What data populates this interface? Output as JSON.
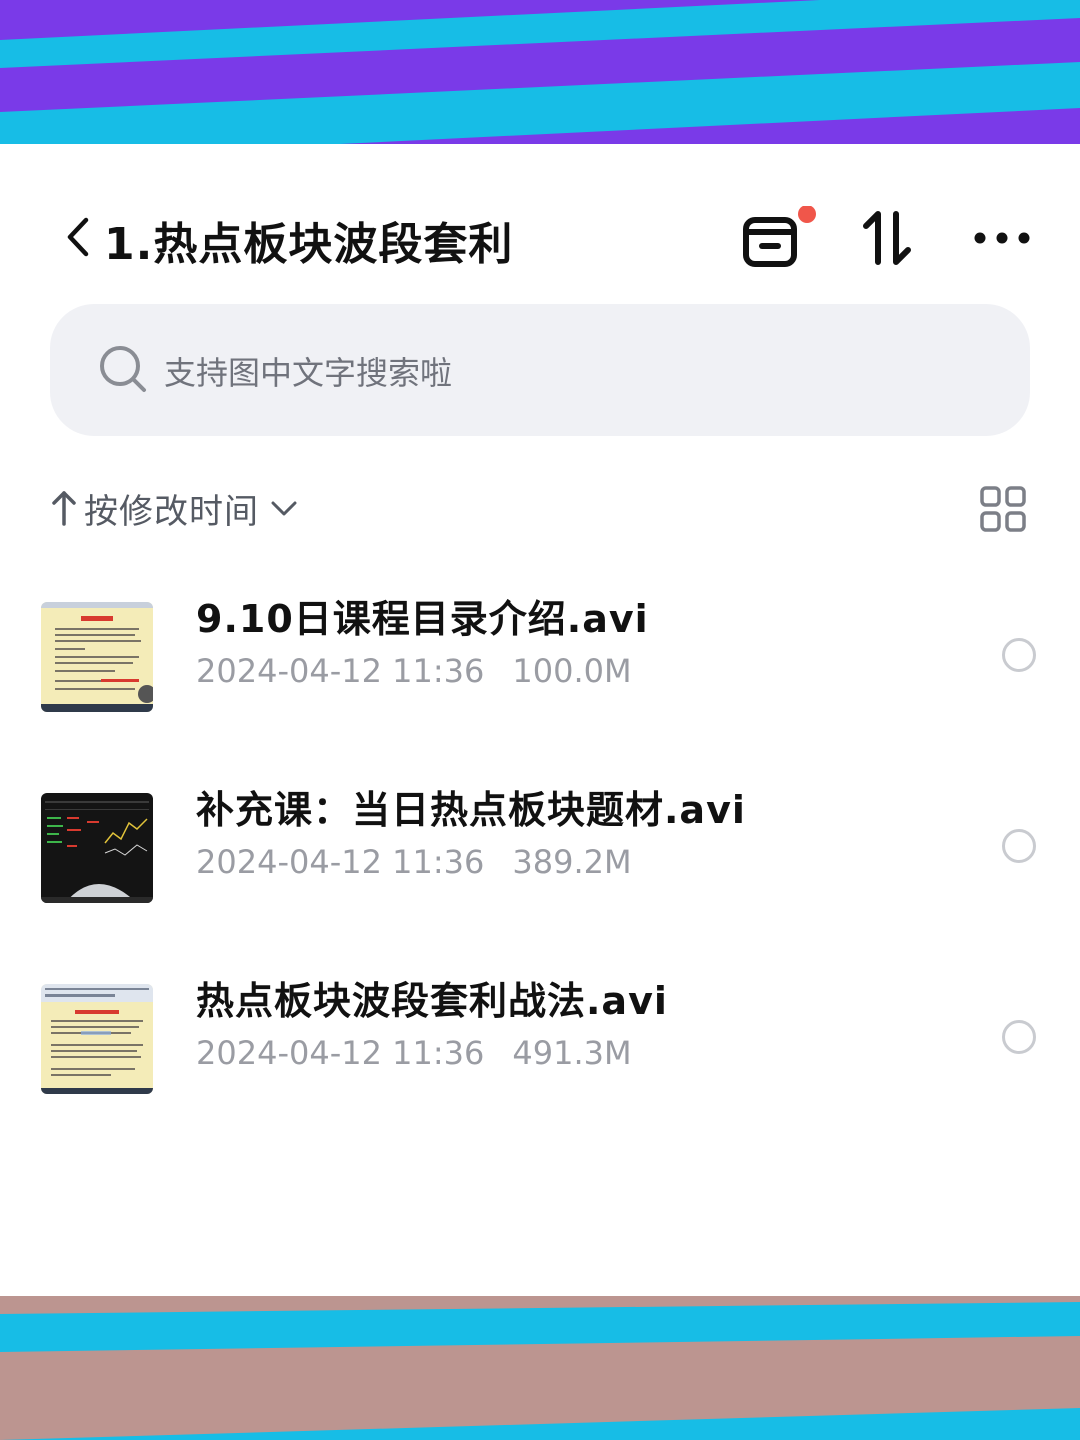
{
  "header": {
    "title": "1.热点板块波段套利",
    "recycle_badge_color": "#f0564a"
  },
  "search": {
    "placeholder": "支持图中文字搜索啦"
  },
  "sort": {
    "label": "按修改时间",
    "direction": "ascending"
  },
  "files": [
    {
      "name": "9.10日课程目录介绍.avi",
      "modified": "2024-04-12 11:36",
      "size": "100.0M",
      "thumbnail": "doc-preview-yellow"
    },
    {
      "name": "补充课：当日热点板块题材.avi",
      "modified": "2024-04-12 11:36",
      "size": "389.2M",
      "thumbnail": "stock-chart-dark"
    },
    {
      "name": "热点板块波段套利战法.avi",
      "modified": "2024-04-12 11:36",
      "size": "491.3M",
      "thumbnail": "doc-preview-yellow"
    }
  ],
  "colors": {
    "banner_purple": "#7a3ae8",
    "banner_cyan": "#17bde6",
    "banner_rose": "#bc9590"
  }
}
